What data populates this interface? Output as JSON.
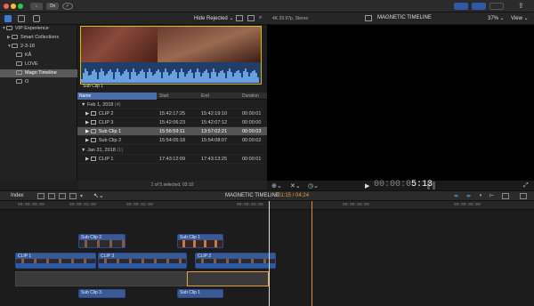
{
  "toolbar": {
    "import_icon": "download-icon",
    "key_label": "On",
    "check_icon": "checkmark-circle-icon",
    "view_buttons": [
      "browser-layout-icon",
      "timeline-layout-icon",
      "inspector-layout-icon"
    ],
    "share_icon": "share-icon"
  },
  "bar2": {
    "filter_label": "Hide Rejected ⌄",
    "format_label": "4K 29.97p, Stereo",
    "viewer_title": "MAGNETIC TIMELINE",
    "zoom_label": "37% ⌄",
    "view_label": "View ⌄"
  },
  "sidebar": {
    "items": [
      {
        "label": "VIP Experience",
        "level": 0,
        "tri": "▼"
      },
      {
        "label": "Smart Collections",
        "level": 1,
        "tri": "▶"
      },
      {
        "label": "2-3-18",
        "level": 1,
        "tri": "▼"
      },
      {
        "label": "KÅ",
        "level": 2,
        "tri": ""
      },
      {
        "label": "LOVE",
        "level": 2,
        "tri": ""
      },
      {
        "label": "Magn Timeline",
        "level": 2,
        "tri": "",
        "selected": true
      },
      {
        "label": "O",
        "level": 2,
        "tri": ""
      }
    ]
  },
  "browser": {
    "thumb_label": "Sub Clip 1",
    "columns": [
      "Name",
      "Start",
      "End",
      "Duration"
    ],
    "rows": [
      {
        "name": "Feb 1, 2018",
        "count": "(4)",
        "group": true
      },
      {
        "name": "CLIP 2",
        "start": "15:42:17:25",
        "end": "15:42:19:10",
        "dur": "00:00:01"
      },
      {
        "name": "CLIP 3",
        "start": "15:42:06:23",
        "end": "15:42:07:12",
        "dur": "00:00:00"
      },
      {
        "name": "Sub Clip 1",
        "start": "15:56:59:11",
        "end": "13:57:02:21",
        "dur": "00:00:03",
        "selected": true
      },
      {
        "name": "Sub Clip 2",
        "start": "15:54:05:18",
        "end": "15:54:08:07",
        "dur": "00:00:02"
      },
      {
        "name": "Jan 31, 2018",
        "count": "(1)",
        "group": true
      },
      {
        "name": "CLIP 1",
        "start": "17:43:12:09",
        "end": "17:43:13:25",
        "dur": "00:00:01"
      }
    ],
    "footer": "1 of 5 selected, 03:10"
  },
  "viewer": {
    "timecode_dim": "00:00:0",
    "timecode_bright": "5:13"
  },
  "timeline": {
    "index_label": "Index",
    "title": "MAGNETIC TIMELINE",
    "position": "01:15 / 04:24",
    "ruler": [
      "00:00:00:00",
      "00:00:01:00",
      "00:00:02:00",
      "00:00:03:00",
      "00:00:04:00",
      "00:00:05:00"
    ],
    "clips": {
      "sub2": "Sub Clip 2",
      "sub1": "Sub Clip 1",
      "clip1": "CLIP 1",
      "clip3": "CLIP 3",
      "clip2": "CLIP 2",
      "sub3": "Sub Clip 3",
      "sub1b": "Sub Clip 1"
    }
  }
}
